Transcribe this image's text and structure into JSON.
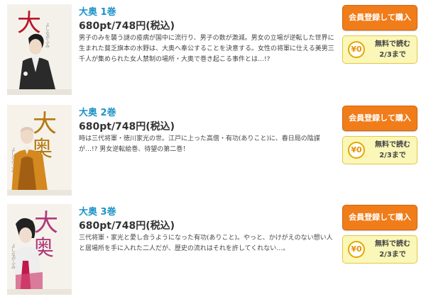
{
  "items": [
    {
      "title": "大奥 1巻",
      "price": "680pt/748円(税込)",
      "description": "男子のみを襲う謎の疫病が国中に流行り、男子の数が激減。男女の立場が逆転した世界に生まれた貧乏旗本の水野は、大奥へ奉公することを決意する。女性の将軍に仕える美男三千人が集められた女人禁制の場所・大奥で巻き起こる事件とは…!?",
      "register_label": "会員登録して購入",
      "free_label": "無料で読む\n2/3まで",
      "coin_label": "¥0",
      "cover_author": "よしながふみ",
      "cover_icon": "samurai-cover-illustration"
    },
    {
      "title": "大奥 2巻",
      "price": "680pt/748円(税込)",
      "description": "時は三代将軍・徳川家光の世。江戸に上った高僧・有功(ありこと)に、春日局の陰謀が…!? 男女逆転絵巻、待望の第二巻！",
      "register_label": "会員登録して購入",
      "free_label": "無料で読む\n2/3まで",
      "coin_label": "¥0",
      "cover_author": "よしながふみ",
      "cover_icon": "monk-cover-illustration"
    },
    {
      "title": "大奥 3巻",
      "price": "680pt/748円(税込)",
      "description": "三代将軍・家光と愛し合うようになった有功(ありこと)。やっと、かけがえのない想い人と居場所を手に入れた二人だが、歴史の流れはそれを許してくれない…。",
      "register_label": "会員登録して購入",
      "free_label": "無料で読む\n2/3まで",
      "coin_label": "¥0",
      "cover_author": "よしながふみ",
      "cover_icon": "shogun-cover-illustration"
    }
  ],
  "colors": {
    "title_link": "#1e93c6",
    "register_button": "#f07d1a",
    "free_button": "#faf7b8",
    "coin": "#e69300"
  }
}
